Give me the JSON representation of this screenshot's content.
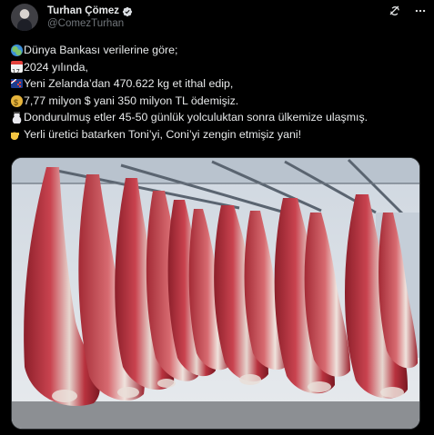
{
  "author": {
    "display_name": "Turhan Çömez",
    "handle": "@ComezTurhan",
    "verified": true
  },
  "header_icons": {
    "refresh": "grok-icon",
    "more": "more-icon"
  },
  "tweet": {
    "lines": [
      {
        "emoji": "globe-icon",
        "text": "Dünya Bankası verilerine göre;"
      },
      {
        "emoji": "calendar-icon",
        "text": "2024 yılında,"
      },
      {
        "emoji": "new-zealand-flag-icon",
        "text": "Yeni Zelanda’dan 470.622 kg et ithal edip,"
      },
      {
        "emoji": "money-bag-icon",
        "text": "7,77 milyon $ yani 350 milyon TL ödemişiz."
      },
      {
        "emoji": "snowman-icon",
        "text": "Dondurulmuş etler 45-50 günlük yolculuktan sonra ülkemize ulaşmış."
      },
      {
        "emoji": "pointing-hand-icon",
        "text": "Yerli üretici batarken Toni’yi, Coni’yi zengin etmişiz yani!"
      }
    ]
  },
  "media": {
    "image": "hanging-meat-carcasses-cold-storage-photo"
  },
  "colors": {
    "background": "#000000",
    "text_primary": "#e7e9ea",
    "text_secondary": "#71767b",
    "verified": "#1d9bf0"
  }
}
